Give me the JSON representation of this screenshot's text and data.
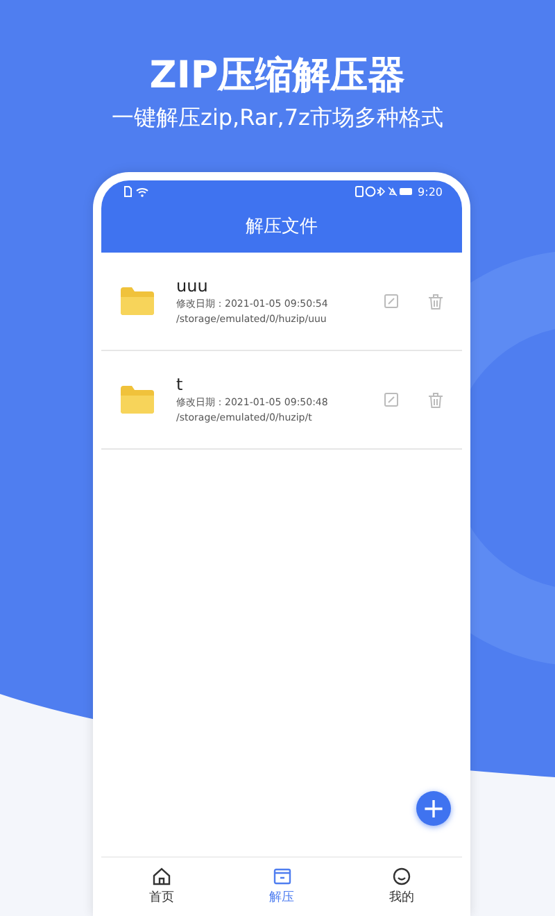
{
  "promo": {
    "title": "ZIP压缩解压器",
    "subtitle": "一键解压zip,Rar,7z市场多种格式"
  },
  "status_bar": {
    "time": "9:20"
  },
  "header": {
    "title": "解压文件"
  },
  "files": [
    {
      "name": "uuu",
      "modified": "修改日期：2021-01-05 09:50:54",
      "path": "/storage/emulated/0/huzip/uuu"
    },
    {
      "name": "t",
      "modified": "修改日期：2021-01-05 09:50:48",
      "path": "/storage/emulated/0/huzip/t"
    }
  ],
  "fab": {
    "label": "+"
  },
  "nav": [
    {
      "kind": "home",
      "label": "首页",
      "selected": false
    },
    {
      "kind": "unzip",
      "label": "解压",
      "selected": true
    },
    {
      "kind": "me",
      "label": "我的",
      "selected": false
    }
  ]
}
